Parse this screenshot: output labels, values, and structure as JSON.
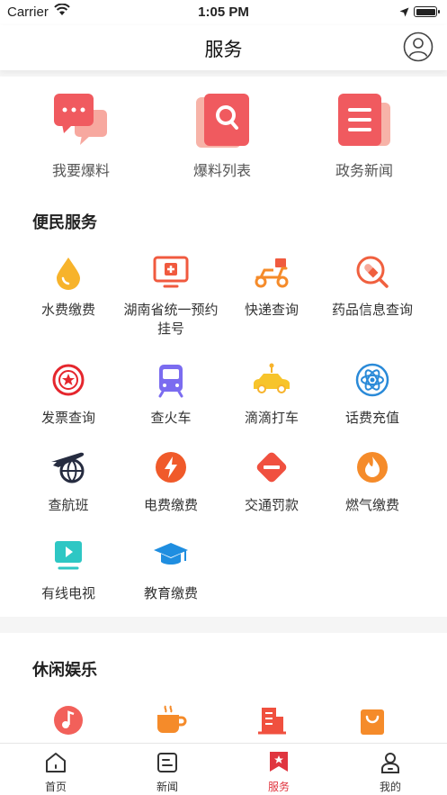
{
  "status_bar": {
    "carrier": "Carrier",
    "time": "1:05 PM"
  },
  "header": {
    "title": "服务"
  },
  "top_actions": [
    {
      "label": "我要爆料",
      "icon": "chat-bubbles-icon"
    },
    {
      "label": "爆料列表",
      "icon": "search-list-icon"
    },
    {
      "label": "政务新闻",
      "icon": "news-document-icon"
    }
  ],
  "convenience": {
    "title": "便民服务",
    "items": [
      {
        "label": "水费缴费",
        "icon": "water-drop-icon"
      },
      {
        "label": "湖南省统一预约挂号",
        "icon": "hospital-icon"
      },
      {
        "label": "快递查询",
        "icon": "delivery-scooter-icon"
      },
      {
        "label": "药品信息查询",
        "icon": "pill-search-icon"
      },
      {
        "label": "发票查询",
        "icon": "invoice-seal-icon"
      },
      {
        "label": "查火车",
        "icon": "train-icon"
      },
      {
        "label": "滴滴打车",
        "icon": "taxi-icon"
      },
      {
        "label": "话费充值",
        "icon": "atom-phone-icon"
      },
      {
        "label": "查航班",
        "icon": "airplane-globe-icon"
      },
      {
        "label": "电费缴费",
        "icon": "lightning-icon"
      },
      {
        "label": "交通罚款",
        "icon": "traffic-fine-icon"
      },
      {
        "label": "燃气缴费",
        "icon": "flame-icon"
      },
      {
        "label": "有线电视",
        "icon": "tv-play-icon"
      },
      {
        "label": "教育缴费",
        "icon": "graduation-cap-icon"
      }
    ]
  },
  "leisure": {
    "title": "休闲娱乐",
    "items": [
      {
        "label": "",
        "icon": "music-note-icon"
      },
      {
        "label": "",
        "icon": "coffee-cup-icon"
      },
      {
        "label": "",
        "icon": "building-icon"
      },
      {
        "label": "",
        "icon": "shopping-bag-icon"
      }
    ]
  },
  "tab_bar": {
    "active": "服务",
    "accent_color": "#e0353f",
    "tabs": [
      {
        "label": "首页",
        "icon": "home-icon"
      },
      {
        "label": "新闻",
        "icon": "news-icon"
      },
      {
        "label": "服务",
        "icon": "service-bookmark-icon"
      },
      {
        "label": "我的",
        "icon": "profile-icon"
      }
    ]
  }
}
